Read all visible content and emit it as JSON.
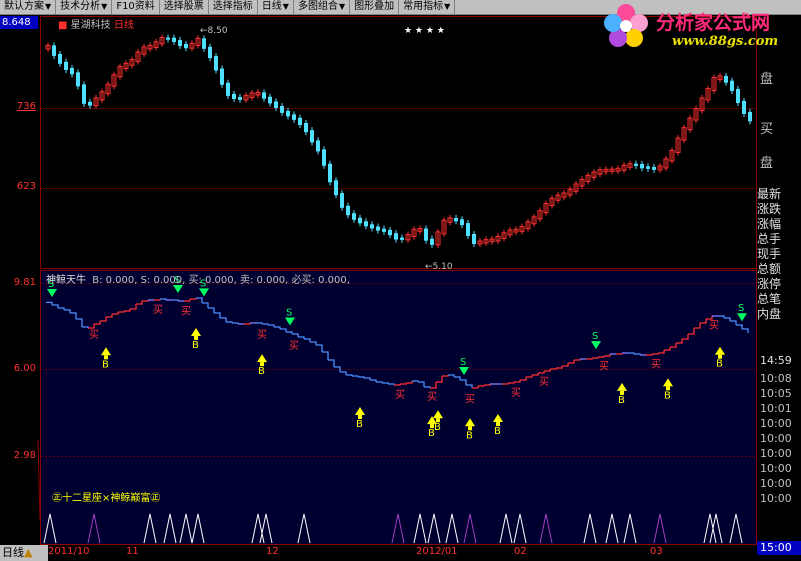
{
  "toolbar": {
    "items": [
      "默认方案",
      "技术分析",
      "F10资料",
      "选择股票",
      "选择指标",
      "日线",
      "多图组合",
      "图形叠加",
      "常用指标"
    ]
  },
  "logo": {
    "title": "分析家公式网",
    "url": "www.88gs.com"
  },
  "stock": {
    "name": "星湖科技",
    "period": "日线",
    "current_price": "8.648"
  },
  "price_axis": {
    "labels": [
      "736",
      "623"
    ]
  },
  "annotations": {
    "high": "8.50",
    "low": "5.10",
    "stars": "★  ★  ★  ★"
  },
  "indicator": {
    "name": "神鲸天牛",
    "legend": "B: 0.000,  S: 0.000,  买: 0.000,  卖: 0.000,  必买: 0.000,",
    "axis_labels": [
      "9.81",
      "6.00",
      "2.98"
    ],
    "subtitle": "㊣十二星座×神鲸巅富㊣"
  },
  "right_panel": {
    "top_labels": [
      "盘",
      "买",
      "盘"
    ],
    "menu": [
      "最新",
      "涨跌",
      "涨幅",
      "总手",
      "现手",
      "总额",
      "涨停",
      "总笔",
      "内盘"
    ],
    "times": [
      "14:59",
      "10:08",
      "10:05",
      "10:01",
      "10:00",
      "10:00",
      "10:00",
      "10:00",
      "10:00",
      "10:00",
      "15:00"
    ]
  },
  "date_axis": {
    "labels": [
      "2011/10",
      "11",
      "12",
      "2012/01",
      "02",
      "03"
    ]
  },
  "bottom_bar": {
    "label": "日线"
  },
  "colors": {
    "up": "#ff3030",
    "down": "#50e0ff",
    "panel_bg": "#000030",
    "signal_yellow": "#ffff00"
  }
}
